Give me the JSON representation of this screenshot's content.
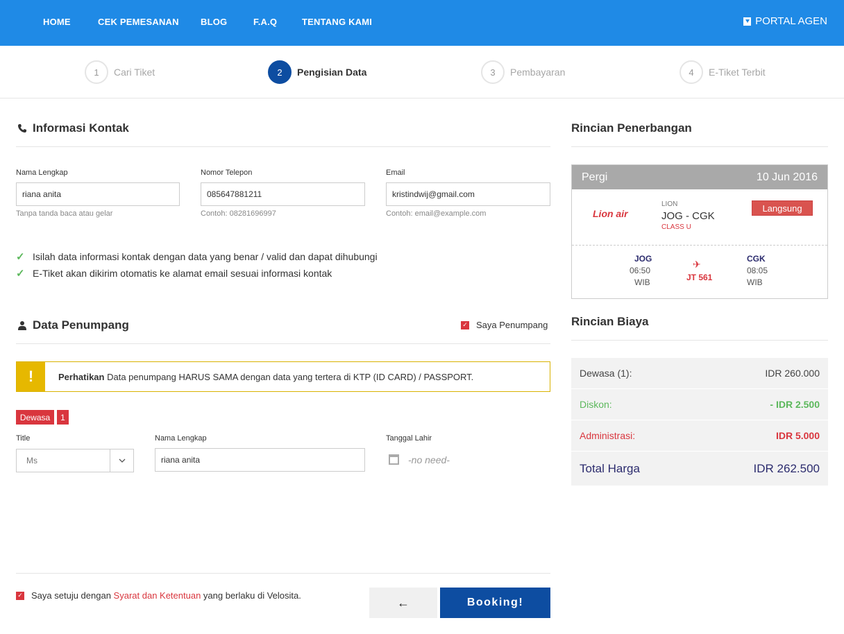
{
  "nav": {
    "items": [
      "HOME",
      "CEK PEMESANAN",
      "BLOG",
      "F.A.Q",
      "TENTANG KAMI"
    ],
    "portal": "PORTAL AGEN"
  },
  "steps": [
    {
      "num": "1",
      "label": "Cari Tiket"
    },
    {
      "num": "2",
      "label": "Pengisian Data"
    },
    {
      "num": "3",
      "label": "Pembayaran"
    },
    {
      "num": "4",
      "label": "E-Tiket Terbit"
    }
  ],
  "contact": {
    "title": "Informasi Kontak",
    "name_label": "Nama Lengkap",
    "name_value": "riana anita",
    "name_hint": "Tanpa tanda baca atau gelar",
    "phone_label": "Nomor Telepon",
    "phone_value": "085647881211",
    "phone_hint": "Contoh: 08281696997",
    "email_label": "Email",
    "email_value": "kristindwij@gmail.com",
    "email_hint": "Contoh: email@example.com",
    "notes": [
      "Isilah data informasi kontak dengan data yang benar / valid dan dapat dihubungi",
      "E-Tiket akan dikirim otomatis ke alamat email sesuai informasi kontak"
    ]
  },
  "passenger": {
    "title": "Data Penumpang",
    "self_checkbox": "Saya Penumpang",
    "warning_bold": "Perhatikan",
    "warning_text": " Data penumpang HARUS SAMA dengan data yang tertera di KTP (ID CARD) / PASSPORT.",
    "type_badge": "Dewasa",
    "count_badge": "1",
    "title_label": "Title",
    "title_value": "Ms",
    "name_label": "Nama Lengkap",
    "name_value": "riana anita",
    "dob_label": "Tanggal Lahir",
    "dob_value": "-no need-"
  },
  "footer": {
    "agree_prefix": "Saya setuju dengan ",
    "agree_link": "Syarat dan Ketentuan",
    "agree_suffix": " yang berlaku di Velosita.",
    "back_icon": "←",
    "booking": "Booking!"
  },
  "flight": {
    "title": "Rincian Penerbangan",
    "direction": "Pergi",
    "date": "10 Jun 2016",
    "airline_logo_text": "Lion air",
    "airline": "LION",
    "route": "JOG - CGK",
    "class": "CLASS U",
    "type": "Langsung",
    "from_code": "JOG",
    "from_time": "06:50",
    "from_tz": "WIB",
    "to_code": "CGK",
    "to_time": "08:05",
    "to_tz": "WIB",
    "flight_no": "JT 561"
  },
  "cost": {
    "title": "Rincian Biaya",
    "rows": [
      {
        "label": "Dewasa (1):",
        "value": "IDR 260.000"
      },
      {
        "label": "Diskon:",
        "value": "- IDR 2.500"
      },
      {
        "label": "Administrasi:",
        "value": "IDR 5.000"
      },
      {
        "label": "Total Harga",
        "value": "IDR 262.500"
      }
    ]
  },
  "colors": {
    "nav_bg": "#1f8ae6",
    "primary": "#0d4da1",
    "accent_red": "#d9363e",
    "success_green": "#5cb85c",
    "warning_yellow": "#e6b800"
  }
}
